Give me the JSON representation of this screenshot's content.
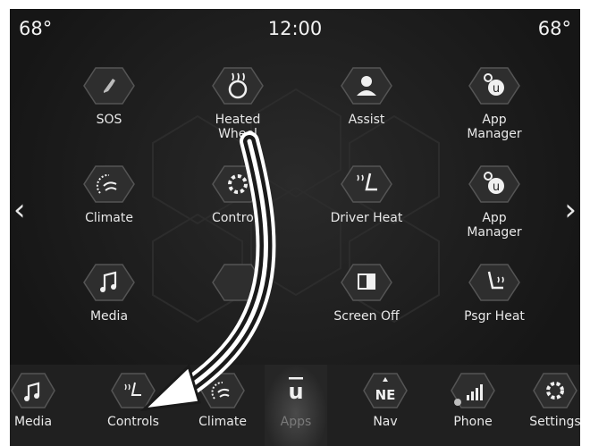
{
  "status": {
    "temp_left": "68°",
    "clock": "12:00",
    "temp_right": "68°"
  },
  "apps": [
    {
      "label": "SOS",
      "icon": "phone-icon"
    },
    {
      "label": "Heated\nWheel",
      "icon": "heated-wheel-icon"
    },
    {
      "label": "Assist",
      "icon": "assist-icon"
    },
    {
      "label": "App\nManager",
      "icon": "app-manager-icon"
    },
    {
      "label": "Climate",
      "icon": "climate-icon"
    },
    {
      "label": "Controls",
      "icon": "controls-icon"
    },
    {
      "label": "Driver Heat",
      "icon": "driver-heat-icon"
    },
    {
      "label": "App\nManager",
      "icon": "app-manager-icon"
    },
    {
      "label": "Media",
      "icon": "music-note-icon"
    },
    {
      "label": "Screen Off",
      "icon": "screen-off-icon"
    },
    {
      "label": "Psgr Heat",
      "icon": "passenger-heat-icon"
    }
  ],
  "nav": {
    "prev": "‹",
    "next": "›"
  },
  "dock": [
    {
      "label": "Media",
      "icon": "music-note-icon"
    },
    {
      "label": "Controls",
      "icon": "controls-seat-icon"
    },
    {
      "label": "Climate",
      "icon": "climate-icon"
    },
    {
      "label": "Apps",
      "icon": "uconnect-icon",
      "active": true
    },
    {
      "label": "Nav",
      "icon": "compass-icon",
      "badge": "NE"
    },
    {
      "label": "Phone",
      "icon": "phone-signal-icon"
    },
    {
      "label": "Settings",
      "icon": "gear-icon"
    }
  ],
  "colors": {
    "background": "#1a1a1a",
    "text": "#e8e8e8",
    "dock": "#202020"
  }
}
